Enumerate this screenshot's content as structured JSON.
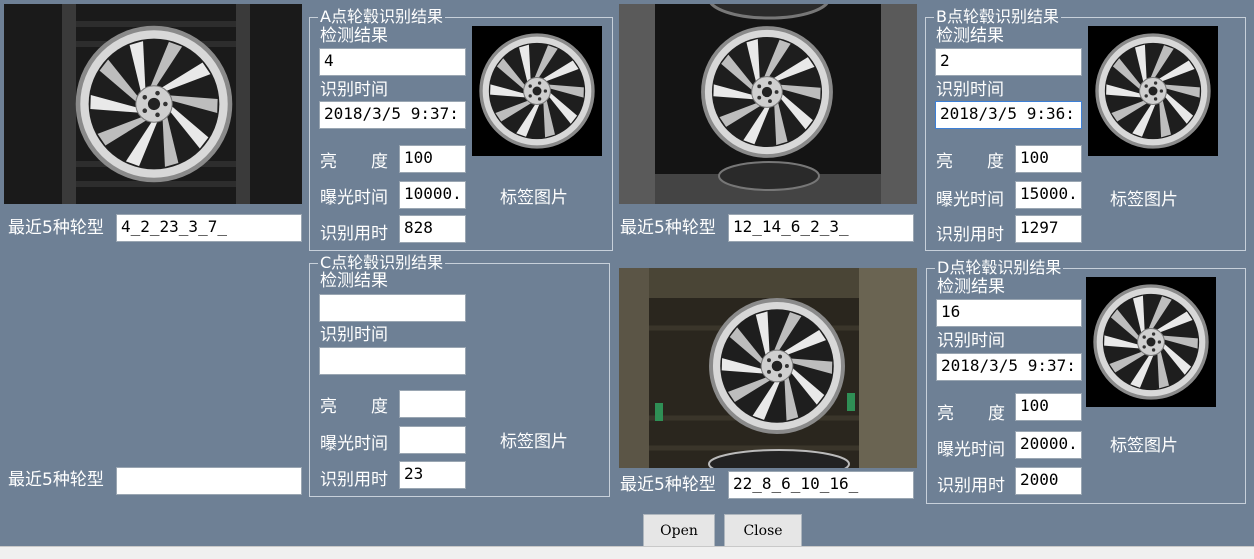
{
  "panels": {
    "A": {
      "title": "A点轮毂识别结果",
      "result_label": "检测结果",
      "result_value": "4",
      "time_label": "识别时间",
      "time_value": "2018/3/5 9:37:",
      "brightness_label": "亮　　度",
      "brightness_value": "100",
      "exposure_label": "曝光时间",
      "exposure_value": "10000.",
      "duration_label": "识别用时",
      "duration_value": "828",
      "tag_label": "标签图片",
      "recent_label": "最近5种轮型",
      "recent_value": "4_2_23_3_7_"
    },
    "B": {
      "title": "B点轮毂识别结果",
      "result_label": "检测结果",
      "result_value": "2",
      "time_label": "识别时间",
      "time_value": "2018/3/5 9:36:",
      "brightness_label": "亮　　度",
      "brightness_value": "100",
      "exposure_label": "曝光时间",
      "exposure_value": "15000.",
      "duration_label": "识别用时",
      "duration_value": "1297",
      "tag_label": "标签图片",
      "recent_label": "最近5种轮型",
      "recent_value": "12_14_6_2_3_"
    },
    "C": {
      "title": "C点轮毂识别结果",
      "result_label": "检测结果",
      "result_value": "",
      "time_label": "识别时间",
      "time_value": "",
      "brightness_label": "亮　　度",
      "brightness_value": "",
      "exposure_label": "曝光时间",
      "exposure_value": "",
      "duration_label": "识别用时",
      "duration_value": "23",
      "tag_label": "标签图片",
      "recent_label": "最近5种轮型",
      "recent_value": ""
    },
    "D": {
      "title": "D点轮毂识别结果",
      "result_label": "检测结果",
      "result_value": "16",
      "time_label": "识别时间",
      "time_value": "2018/3/5 9:37:",
      "brightness_label": "亮　　度",
      "brightness_value": "100",
      "exposure_label": "曝光时间",
      "exposure_value": "20000.",
      "duration_label": "识别用时",
      "duration_value": "2000",
      "tag_label": "标签图片",
      "recent_label": "最近5种轮型",
      "recent_value": "22_8_6_10_16_"
    }
  },
  "buttons": {
    "open": "Open",
    "close": "Close"
  },
  "colors": {
    "background": "#6e8095",
    "field": "#ffffff",
    "image_bg": "#000000"
  },
  "icons": [
    "wheel-image",
    "camera-image"
  ]
}
